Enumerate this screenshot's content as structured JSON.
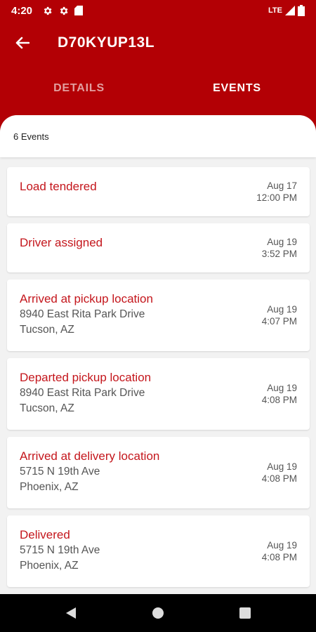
{
  "status_bar": {
    "time": "4:20",
    "network": "LTE",
    "icons": [
      "settings-icon",
      "settings-icon",
      "sim-card-icon",
      "signal-icon",
      "battery-icon"
    ]
  },
  "app_bar": {
    "title": "D70KYUP13L",
    "back_icon": "arrow-left-icon"
  },
  "tabs": [
    {
      "label": "DETAILS",
      "active": false
    },
    {
      "label": "EVENTS",
      "active": true
    }
  ],
  "events_summary": "6 Events",
  "events": [
    {
      "title": "Load tendered",
      "address_line1": "",
      "address_line2": "",
      "date": "Aug 17",
      "time": "12:00 PM"
    },
    {
      "title": "Driver assigned",
      "address_line1": "",
      "address_line2": "",
      "date": "Aug 19",
      "time": "3:52 PM"
    },
    {
      "title": "Arrived at pickup location",
      "address_line1": "8940 East Rita Park Drive",
      "address_line2": "Tucson, AZ",
      "date": "Aug 19",
      "time": "4:07 PM"
    },
    {
      "title": "Departed pickup location",
      "address_line1": "8940 East Rita Park Drive",
      "address_line2": "Tucson, AZ",
      "date": "Aug 19",
      "time": "4:08 PM"
    },
    {
      "title": "Arrived at delivery location",
      "address_line1": "5715 N 19th Ave",
      "address_line2": "Phoenix, AZ",
      "date": "Aug 19",
      "time": "4:08 PM"
    },
    {
      "title": "Delivered",
      "address_line1": "5715 N 19th Ave",
      "address_line2": "Phoenix, AZ",
      "date": "Aug 19",
      "time": "4:08 PM"
    }
  ],
  "nav_bar": {
    "buttons": [
      "back-triangle-icon",
      "home-circle-icon",
      "recents-square-icon"
    ]
  },
  "colors": {
    "brand_red": "#b30005",
    "event_title_red": "#c4161c",
    "background": "#f2f2f2"
  }
}
